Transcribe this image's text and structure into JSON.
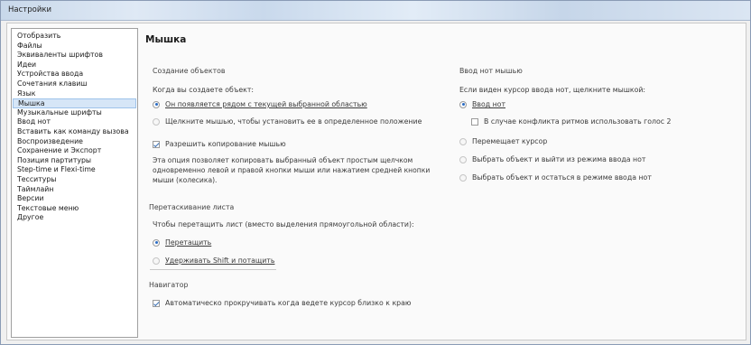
{
  "window": {
    "title": "Настройки"
  },
  "sidebar": {
    "items": [
      {
        "label": "Отобразить"
      },
      {
        "label": "Файлы"
      },
      {
        "label": "Эквиваленты шрифтов"
      },
      {
        "label": "Идеи"
      },
      {
        "label": "Устройства ввода"
      },
      {
        "label": "Сочетания клавиш"
      },
      {
        "label": "Язык"
      },
      {
        "label": "Мышка",
        "selected": true
      },
      {
        "label": "Музыкальные шрифты"
      },
      {
        "label": "Ввод нот"
      },
      {
        "label": "Вставить как команду вызова"
      },
      {
        "label": "Воспроизведение"
      },
      {
        "label": "Сохранение и Экспорт"
      },
      {
        "label": "Позиция партитуры"
      },
      {
        "label": "Step-time и Flexi-time"
      },
      {
        "label": "Тесситуры"
      },
      {
        "label": "Таймлайн"
      },
      {
        "label": "Версии"
      },
      {
        "label": "Текстовые меню"
      },
      {
        "label": "Другое"
      }
    ]
  },
  "page": {
    "title": "Мышка",
    "create": {
      "label": "Создание объектов",
      "prompt": "Когда вы создаете объект:",
      "opt1": "Он появляется рядом с текущей выбранной областью",
      "opt2": "Щелкните мышью, чтобы установить ее  в определенное положение",
      "copy": "Разрешить копирование мышью",
      "desc": "Эта опция позволяет копировать выбранный объект простым щелчком одновременно левой и правой кнопки мыши или нажатием средней кнопки мыши (колесика)."
    },
    "drag": {
      "label": "Перетаскивание листа",
      "prompt": "Чтобы перетащить лист (вместо выделения прямоугольной области):",
      "opt1": "Перетащить",
      "opt2": "Удерживать Shift и потащить"
    },
    "nav": {
      "label": "Навигатор",
      "autoscroll": "Автоматическо прокручивать когда ведете курсор близко к краю"
    },
    "notes": {
      "label": "Ввод нот мышью",
      "prompt": "Если виден курсор ввода нот, щелкните мышкой:",
      "opt1": "Ввод нот",
      "sub": "В случае конфликта ритмов использовать голос 2",
      "opt2": "Перемещает курсор",
      "opt3": "Выбрать объект и выйти из режима ввода нот",
      "opt4": "Выбрать объект и остаться в режиме ввода нот"
    }
  }
}
